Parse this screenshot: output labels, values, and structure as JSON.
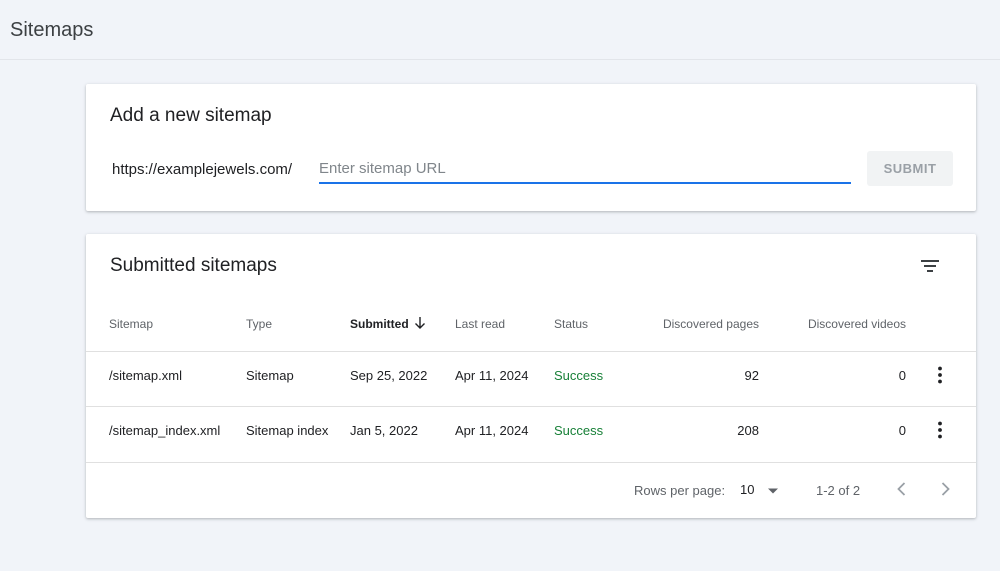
{
  "page": {
    "title": "Sitemaps"
  },
  "add_sitemap": {
    "title": "Add a new sitemap",
    "prefix": "https://examplejewels.com/",
    "input_value": "",
    "input_placeholder": "Enter sitemap URL",
    "submit_label": "SUBMIT"
  },
  "submitted": {
    "title": "Submitted sitemaps",
    "columns": {
      "sitemap": "Sitemap",
      "type": "Type",
      "submitted": "Submitted",
      "last_read": "Last read",
      "status": "Status",
      "pages": "Discovered pages",
      "videos": "Discovered videos"
    },
    "rows": [
      {
        "sitemap": "/sitemap.xml",
        "type": "Sitemap",
        "submitted": "Sep 25, 2022",
        "last_read": "Apr 11, 2024",
        "status": "Success",
        "pages": "92",
        "videos": "0"
      },
      {
        "sitemap": "/sitemap_index.xml",
        "type": "Sitemap index",
        "submitted": "Jan 5, 2022",
        "last_read": "Apr 11, 2024",
        "status": "Success",
        "pages": "208",
        "videos": "0"
      }
    ],
    "pagination": {
      "rows_per_page_label": "Rows per page:",
      "rows_per_page_value": "10",
      "range": "1-2 of 2"
    }
  },
  "icons": {
    "filter": "filter-icon",
    "sort": "arrow-down-icon",
    "row_menu": "more-vert-icon",
    "dropdown": "caret-down-icon",
    "prev": "chevron-left-icon",
    "next": "chevron-right-icon"
  },
  "colors": {
    "accent": "#1a73e8",
    "success": "#188038",
    "background": "#f1f4f9"
  }
}
